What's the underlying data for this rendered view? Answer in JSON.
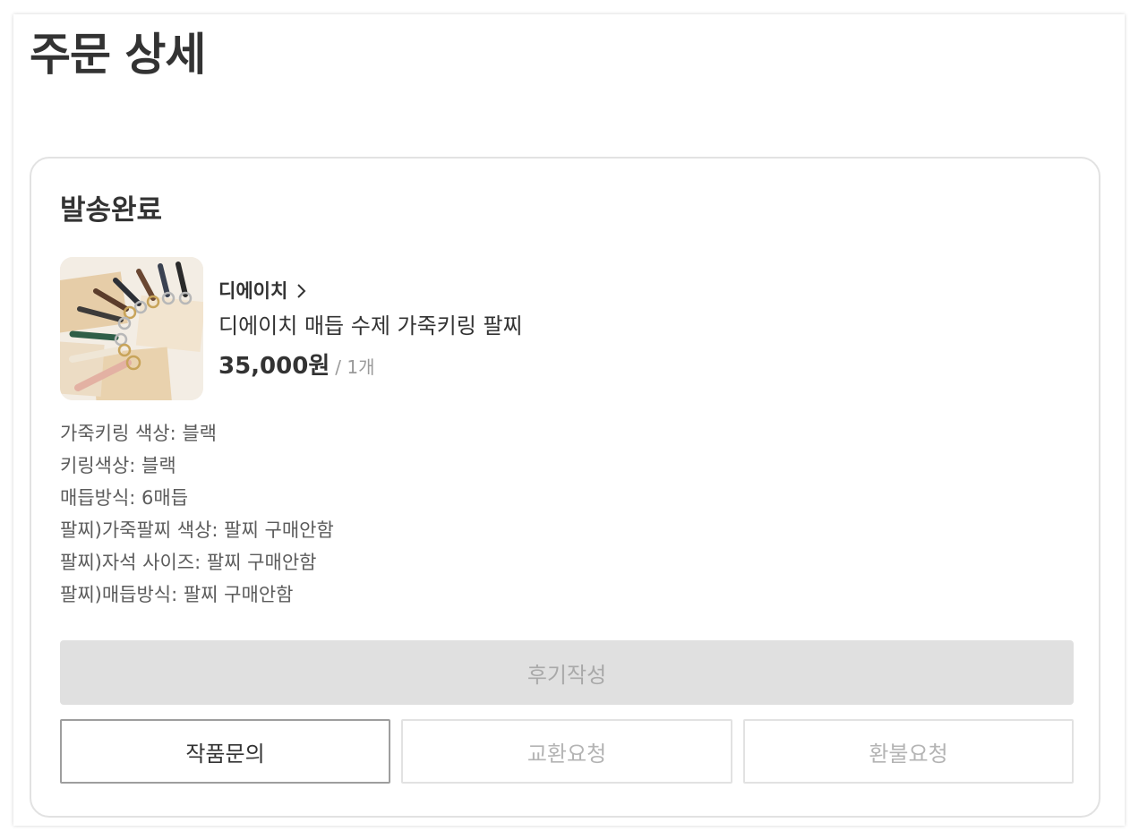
{
  "page": {
    "title": "주문 상세"
  },
  "order": {
    "status": "발송완료",
    "shop": {
      "name": "디에이치",
      "icon": "chevron-right-icon"
    },
    "product": {
      "name": "디에이치 매듭 수제 가죽키링 팔찌",
      "price": "35,000원",
      "quantity": "/ 1개",
      "thumbnail": "product-thumbnail-keyrings"
    },
    "options": [
      "가죽키링 색상: 블랙",
      "키링색상: 블랙",
      "매듭방식: 6매듭",
      "팔찌)가죽팔찌 색상: 팔찌 구매안함",
      "팔찌)자석 사이즈: 팔찌 구매안함",
      "팔찌)매듭방식: 팔찌 구매안함"
    ]
  },
  "actions": {
    "review": "후기작성",
    "inquiry": "작품문의",
    "exchange": "교환요청",
    "refund": "환불요청"
  },
  "colors": {
    "text_primary": "#333333",
    "text_secondary": "#5c5c5c",
    "text_muted": "#9a9a9a",
    "button_disabled_bg": "#e0e0e0",
    "button_disabled_text": "#a9a9a9",
    "card_border": "#e2e2e2"
  }
}
